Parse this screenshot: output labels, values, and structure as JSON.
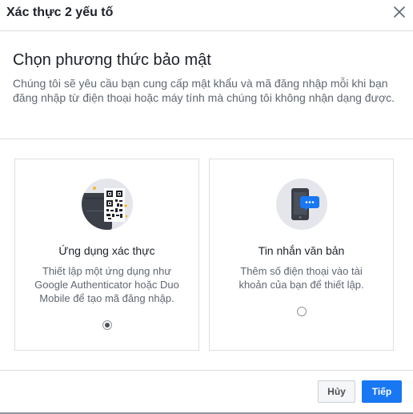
{
  "dialog": {
    "title": "Xác thực 2 yếu tố"
  },
  "intro": {
    "heading": "Chọn phương thức bảo mật",
    "description": "Chúng tôi sẽ yêu cầu bạn cung cấp mật khẩu và mã đăng nhập mỗi khi bạn đăng nhập từ điện thoại hoặc máy tính mà chúng tôi không nhận dạng được."
  },
  "options": [
    {
      "title": "Ứng dụng xác thực",
      "description": "Thiết lập một ứng dụng như Google Authenticator hoặc Duo Mobile để tạo mã đăng nhập.",
      "icon": "authenticator-app-qr-icon",
      "selected": true
    },
    {
      "title": "Tin nhắn văn bản",
      "description": "Thêm số điện thoại vào tài khoản của bạn để thiết lập.",
      "icon": "phone-message-icon",
      "selected": false
    }
  ],
  "footer": {
    "cancel_label": "Hủy",
    "next_label": "Tiếp"
  },
  "colors": {
    "primary": "#1877f2",
    "divider": "#dddfe2",
    "muted_text": "#606770",
    "icon_background": "#e4e6eb",
    "icon_dark": "#3a3f48",
    "message_bubble": "#1877f2"
  },
  "icons": {
    "close": "close-icon"
  }
}
